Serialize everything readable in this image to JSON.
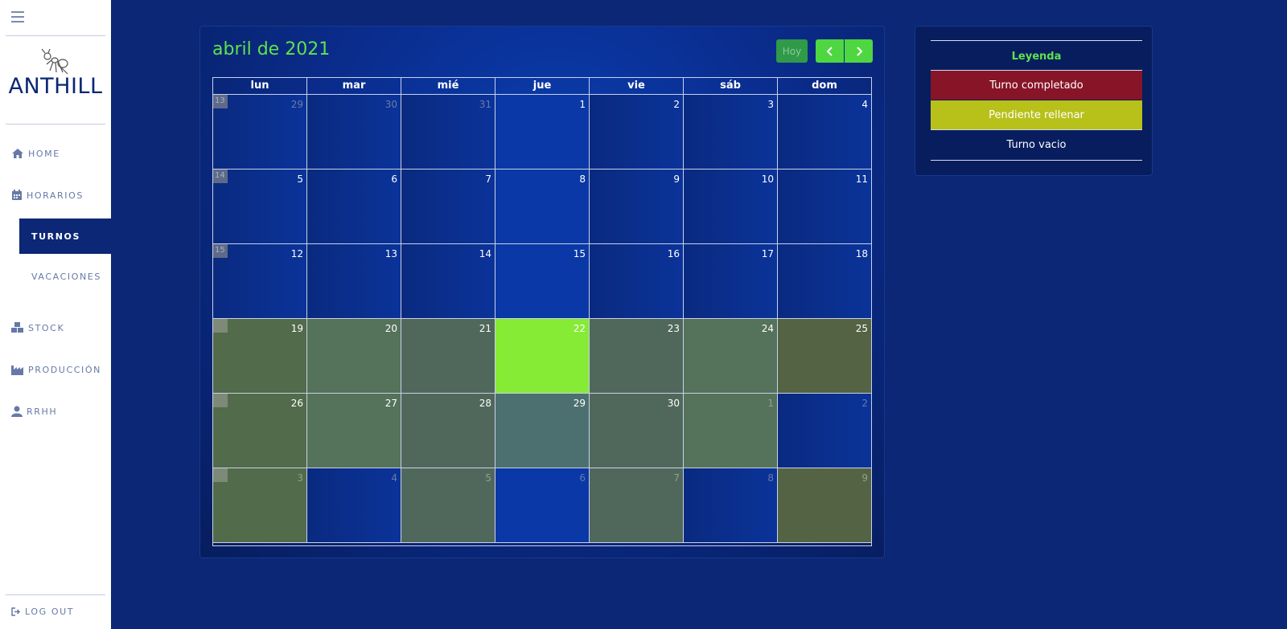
{
  "sidebar": {
    "logo_text": "ANTHILL",
    "nav": {
      "home": "HOME",
      "horarios": "HORARIOS",
      "turnos": "TURNOS",
      "vacaciones": "VACACIONES",
      "stock": "STOCK",
      "produccion": "PRODUCCIÓN",
      "rrhh": "RRHH",
      "logout": "LOG OUT"
    }
  },
  "calendar": {
    "title": "abril de 2021",
    "today_button": "Hoy",
    "weekdays": [
      "lun",
      "mar",
      "mié",
      "jue",
      "vie",
      "sáb",
      "dom"
    ],
    "weeks": [
      {
        "week_number": "13",
        "days": [
          "29",
          "30",
          "31",
          "1",
          "2",
          "3",
          "4"
        ]
      },
      {
        "week_number": "14",
        "days": [
          "5",
          "6",
          "7",
          "8",
          "9",
          "10",
          "11"
        ]
      },
      {
        "week_number": "15",
        "days": [
          "12",
          "13",
          "14",
          "15",
          "16",
          "17",
          "18"
        ]
      },
      {
        "week_number": "",
        "days": [
          "19",
          "20",
          "21",
          "22",
          "23",
          "24",
          "25"
        ]
      },
      {
        "week_number": "",
        "days": [
          "26",
          "27",
          "28",
          "29",
          "30",
          "1",
          "2"
        ]
      },
      {
        "week_number": "",
        "days": [
          "3",
          "4",
          "5",
          "6",
          "7",
          "8",
          "9"
        ]
      }
    ]
  },
  "legend": {
    "title": "Leyenda",
    "completed": "Turno completado",
    "pending": "Pendiente rellenar",
    "empty": "Turno vacio"
  },
  "colors": {
    "accent_green": "#5fe34b",
    "today": "#85eb34",
    "completed": "#881428",
    "pending": "#b8c01a",
    "background": "#0b2775"
  }
}
